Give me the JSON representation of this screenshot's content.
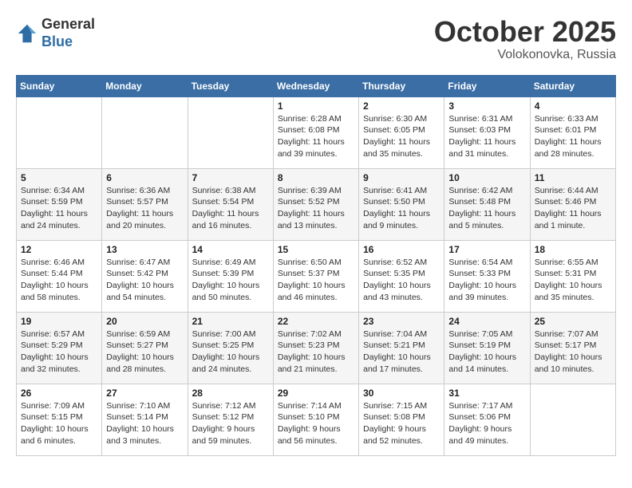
{
  "header": {
    "logo": {
      "general": "General",
      "blue": "Blue"
    },
    "title": "October 2025",
    "location": "Volokonovka, Russia"
  },
  "weekdays": [
    "Sunday",
    "Monday",
    "Tuesday",
    "Wednesday",
    "Thursday",
    "Friday",
    "Saturday"
  ],
  "weeks": [
    [
      null,
      null,
      null,
      {
        "day": "1",
        "sunrise": "6:28 AM",
        "sunset": "6:08 PM",
        "daylight": "11 hours and 39 minutes."
      },
      {
        "day": "2",
        "sunrise": "6:30 AM",
        "sunset": "6:05 PM",
        "daylight": "11 hours and 35 minutes."
      },
      {
        "day": "3",
        "sunrise": "6:31 AM",
        "sunset": "6:03 PM",
        "daylight": "11 hours and 31 minutes."
      },
      {
        "day": "4",
        "sunrise": "6:33 AM",
        "sunset": "6:01 PM",
        "daylight": "11 hours and 28 minutes."
      }
    ],
    [
      {
        "day": "5",
        "sunrise": "6:34 AM",
        "sunset": "5:59 PM",
        "daylight": "11 hours and 24 minutes."
      },
      {
        "day": "6",
        "sunrise": "6:36 AM",
        "sunset": "5:57 PM",
        "daylight": "11 hours and 20 minutes."
      },
      {
        "day": "7",
        "sunrise": "6:38 AM",
        "sunset": "5:54 PM",
        "daylight": "11 hours and 16 minutes."
      },
      {
        "day": "8",
        "sunrise": "6:39 AM",
        "sunset": "5:52 PM",
        "daylight": "11 hours and 13 minutes."
      },
      {
        "day": "9",
        "sunrise": "6:41 AM",
        "sunset": "5:50 PM",
        "daylight": "11 hours and 9 minutes."
      },
      {
        "day": "10",
        "sunrise": "6:42 AM",
        "sunset": "5:48 PM",
        "daylight": "11 hours and 5 minutes."
      },
      {
        "day": "11",
        "sunrise": "6:44 AM",
        "sunset": "5:46 PM",
        "daylight": "11 hours and 1 minute."
      }
    ],
    [
      {
        "day": "12",
        "sunrise": "6:46 AM",
        "sunset": "5:44 PM",
        "daylight": "10 hours and 58 minutes."
      },
      {
        "day": "13",
        "sunrise": "6:47 AM",
        "sunset": "5:42 PM",
        "daylight": "10 hours and 54 minutes."
      },
      {
        "day": "14",
        "sunrise": "6:49 AM",
        "sunset": "5:39 PM",
        "daylight": "10 hours and 50 minutes."
      },
      {
        "day": "15",
        "sunrise": "6:50 AM",
        "sunset": "5:37 PM",
        "daylight": "10 hours and 46 minutes."
      },
      {
        "day": "16",
        "sunrise": "6:52 AM",
        "sunset": "5:35 PM",
        "daylight": "10 hours and 43 minutes."
      },
      {
        "day": "17",
        "sunrise": "6:54 AM",
        "sunset": "5:33 PM",
        "daylight": "10 hours and 39 minutes."
      },
      {
        "day": "18",
        "sunrise": "6:55 AM",
        "sunset": "5:31 PM",
        "daylight": "10 hours and 35 minutes."
      }
    ],
    [
      {
        "day": "19",
        "sunrise": "6:57 AM",
        "sunset": "5:29 PM",
        "daylight": "10 hours and 32 minutes."
      },
      {
        "day": "20",
        "sunrise": "6:59 AM",
        "sunset": "5:27 PM",
        "daylight": "10 hours and 28 minutes."
      },
      {
        "day": "21",
        "sunrise": "7:00 AM",
        "sunset": "5:25 PM",
        "daylight": "10 hours and 24 minutes."
      },
      {
        "day": "22",
        "sunrise": "7:02 AM",
        "sunset": "5:23 PM",
        "daylight": "10 hours and 21 minutes."
      },
      {
        "day": "23",
        "sunrise": "7:04 AM",
        "sunset": "5:21 PM",
        "daylight": "10 hours and 17 minutes."
      },
      {
        "day": "24",
        "sunrise": "7:05 AM",
        "sunset": "5:19 PM",
        "daylight": "10 hours and 14 minutes."
      },
      {
        "day": "25",
        "sunrise": "7:07 AM",
        "sunset": "5:17 PM",
        "daylight": "10 hours and 10 minutes."
      }
    ],
    [
      {
        "day": "26",
        "sunrise": "7:09 AM",
        "sunset": "5:15 PM",
        "daylight": "10 hours and 6 minutes."
      },
      {
        "day": "27",
        "sunrise": "7:10 AM",
        "sunset": "5:14 PM",
        "daylight": "10 hours and 3 minutes."
      },
      {
        "day": "28",
        "sunrise": "7:12 AM",
        "sunset": "5:12 PM",
        "daylight": "9 hours and 59 minutes."
      },
      {
        "day": "29",
        "sunrise": "7:14 AM",
        "sunset": "5:10 PM",
        "daylight": "9 hours and 56 minutes."
      },
      {
        "day": "30",
        "sunrise": "7:15 AM",
        "sunset": "5:08 PM",
        "daylight": "9 hours and 52 minutes."
      },
      {
        "day": "31",
        "sunrise": "7:17 AM",
        "sunset": "5:06 PM",
        "daylight": "9 hours and 49 minutes."
      },
      null
    ]
  ]
}
